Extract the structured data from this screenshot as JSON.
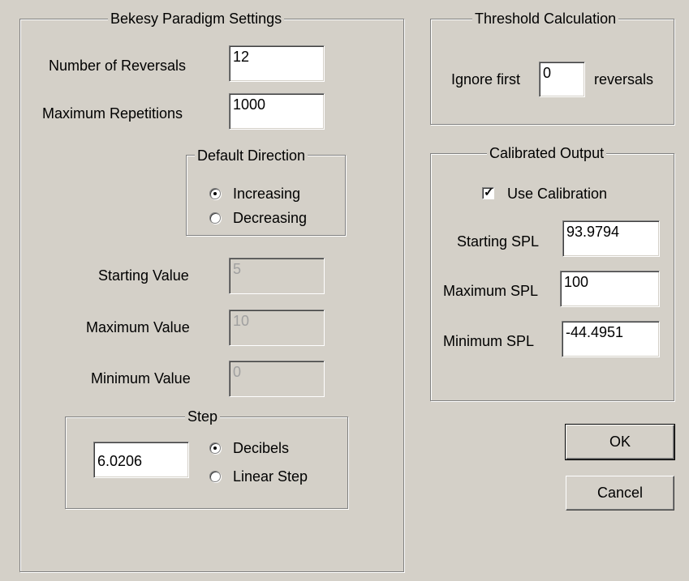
{
  "bekesy": {
    "title": "Bekesy Paradigm Settings",
    "num_reversals_label": "Number of Reversals",
    "num_reversals_value": "12",
    "max_repetitions_label": "Maximum Repetitions",
    "max_repetitions_value": "1000",
    "default_direction": {
      "title": "Default Direction",
      "options": [
        "Increasing",
        "Decreasing"
      ],
      "selected": "Increasing"
    },
    "starting_value_label": "Starting Value",
    "starting_value": "5",
    "maximum_value_label": "Maximum Value",
    "maximum_value": "10",
    "minimum_value_label": "Minimum Value",
    "minimum_value": "0",
    "step": {
      "title": "Step",
      "value": "6.0206",
      "options": [
        "Decibels",
        "Linear Step"
      ],
      "selected": "Decibels"
    }
  },
  "threshold": {
    "title": "Threshold Calculation",
    "ignore_first_label": "Ignore first",
    "ignore_first_value": "0",
    "reversals_label": "reversals"
  },
  "calibrated": {
    "title": "Calibrated Output",
    "use_calibration_label": "Use Calibration",
    "use_calibration_checked": true,
    "starting_spl_label": "Starting SPL",
    "starting_spl_value": "93.9794",
    "maximum_spl_label": "Maximum SPL",
    "maximum_spl_value": "100",
    "minimum_spl_label": "Minimum SPL",
    "minimum_spl_value": "-44.4951"
  },
  "buttons": {
    "ok": "OK",
    "cancel": "Cancel"
  },
  "colors": {
    "dialog_bg": "#d4d0c8",
    "disabled_text": "#a0a0a0"
  }
}
